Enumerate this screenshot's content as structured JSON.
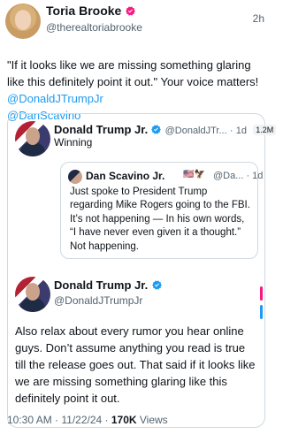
{
  "tweet": {
    "author_name": "Toria Brooke",
    "author_handle": "@therealtoriabrooke",
    "time": "2h",
    "text_part1": "\"If it looks like we are missing something glaring like this definitely point it out.\" Your voice matters! ",
    "mention1": "@DonaldJTrumpJr",
    "mention2": "@DanScavino"
  },
  "quote1": {
    "author_name": "Donald Trump Jr.",
    "author_handle": "@DonaldJTr...",
    "time": "1d",
    "badge": "1.2M",
    "text": "Winning"
  },
  "quote_inner": {
    "author_name": "Dan Scavino Jr.",
    "flags": "🇺🇸🦅",
    "author_handle": "@Da... · 1d",
    "text": "Just spoke to President Trump regarding Mike Rogers going to the FBI. It’s not happening — In his own words, “I have never even given it a thought.” Not happening."
  },
  "quote2": {
    "author_name": "Donald Trump Jr.",
    "author_handle": "@DonaldJTrumpJr",
    "text": "Also relax about every rumor you hear online guys. Don’t assume anything you read is true till the release goes out. That said if it looks like we are missing something glaring like this definitely point it out."
  },
  "footer": {
    "timestamp": "10:30 AM · 11/22/24 · ",
    "views_count": "170K",
    "views_label": " Views"
  },
  "colors": {
    "link": "#1d9bf0",
    "verified": "#1d9bf0",
    "verified_pink": "#f91880"
  }
}
